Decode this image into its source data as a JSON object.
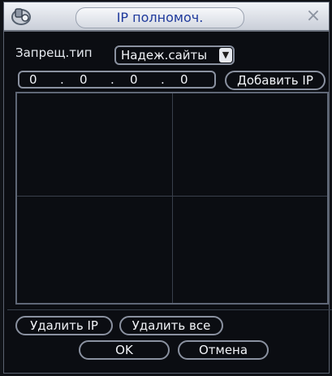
{
  "dialog": {
    "title": "IP полномоч.",
    "close_symbol": "×"
  },
  "filter": {
    "type_label": "Запрещ.тип",
    "type_value": "Надеж.сайты",
    "dropdown_arrow": "▼"
  },
  "ip_input": {
    "octets": [
      "0",
      "0",
      "0",
      "0"
    ],
    "separator": "."
  },
  "buttons": {
    "add_ip": "Добавить IP",
    "delete_ip": "Удалить IP",
    "delete_all": "Удалить все",
    "ok": "OK",
    "cancel": "Отмена"
  },
  "list": {
    "items": []
  },
  "colors": {
    "title_text": "#1f3a9c",
    "background": "#0b0d12",
    "border": "#8a91a0",
    "text": "#f2f4f8"
  }
}
